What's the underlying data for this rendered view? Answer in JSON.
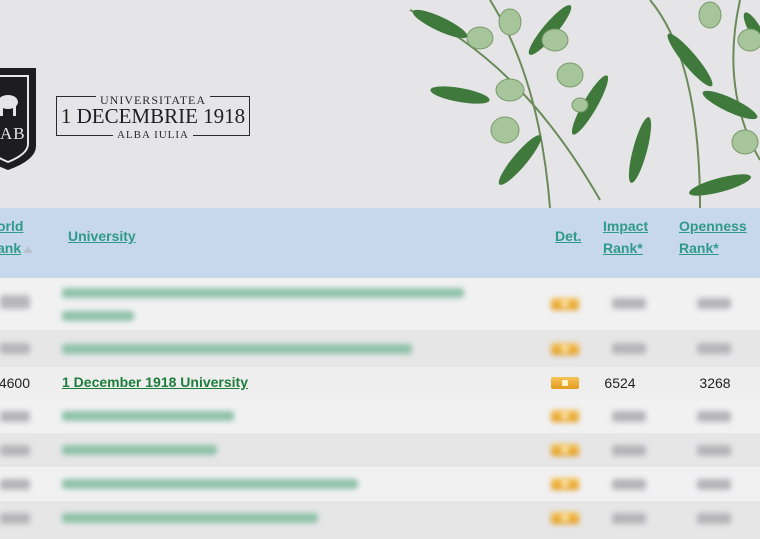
{
  "header": {
    "shield_text": "AB",
    "logo": {
      "line1": "UNIVERSITATEA",
      "line2": "1 DECEMBRIE 1918",
      "line3": "ALBA IULIA"
    },
    "branch_icon": "olive-branch-icon"
  },
  "table": {
    "columns": {
      "world_rank": [
        "orld",
        "ank"
      ],
      "university": "University",
      "det": "Det.",
      "impact_rank": [
        "Impact",
        "Rank*"
      ],
      "openness_rank": [
        "Openness",
        "Rank*"
      ]
    },
    "rows": [
      {
        "rank": "4600",
        "university": "1 December 1918 University",
        "impact": "6524",
        "openness": "3268"
      }
    ]
  },
  "colors": {
    "link": "#2f9a8c",
    "highlight_link": "#1e7d3a",
    "header_bg": "#c8d8ec",
    "det_badge": "#efa730"
  }
}
